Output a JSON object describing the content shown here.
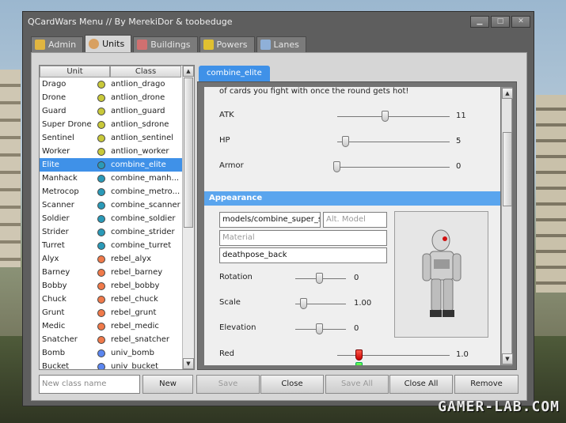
{
  "window": {
    "title": "QCardWars Menu  //  By MerekiDor & toobeduge"
  },
  "tabs": [
    {
      "label": "Admin",
      "color": "#e0b540"
    },
    {
      "label": "Units",
      "color": "#d8a060"
    },
    {
      "label": "Buildings",
      "color": "#d07070"
    },
    {
      "label": "Powers",
      "color": "#e0c030"
    },
    {
      "label": "Lanes",
      "color": "#8fb0d8"
    }
  ],
  "list": {
    "headers": {
      "unit": "Unit",
      "cls": "Class"
    },
    "rows": [
      {
        "unit": "Drago",
        "cls": "antlion_drago",
        "color": "#c9c93a"
      },
      {
        "unit": "Drone",
        "cls": "antlion_drone",
        "color": "#c9c93a"
      },
      {
        "unit": "Guard",
        "cls": "antlion_guard",
        "color": "#c9c93a"
      },
      {
        "unit": "Super Drone",
        "cls": "antlion_sdrone",
        "color": "#c9c93a"
      },
      {
        "unit": "Sentinel",
        "cls": "antlion_sentinel",
        "color": "#c9c93a"
      },
      {
        "unit": "Worker",
        "cls": "antlion_worker",
        "color": "#c9c93a"
      },
      {
        "unit": "Elite",
        "cls": "combine_elite",
        "color": "#2a9ab8",
        "selected": true
      },
      {
        "unit": "Manhack",
        "cls": "combine_manh...",
        "color": "#2a9ab8"
      },
      {
        "unit": "Metrocop",
        "cls": "combine_metro...",
        "color": "#2a9ab8"
      },
      {
        "unit": "Scanner",
        "cls": "combine_scanner",
        "color": "#2a9ab8"
      },
      {
        "unit": "Soldier",
        "cls": "combine_soldier",
        "color": "#2a9ab8"
      },
      {
        "unit": "Strider",
        "cls": "combine_strider",
        "color": "#2a9ab8"
      },
      {
        "unit": "Turret",
        "cls": "combine_turret",
        "color": "#2a9ab8"
      },
      {
        "unit": "Alyx",
        "cls": "rebel_alyx",
        "color": "#f07a4a"
      },
      {
        "unit": "Barney",
        "cls": "rebel_barney",
        "color": "#f07a4a"
      },
      {
        "unit": "Bobby",
        "cls": "rebel_bobby",
        "color": "#f07a4a"
      },
      {
        "unit": "Chuck",
        "cls": "rebel_chuck",
        "color": "#f07a4a"
      },
      {
        "unit": "Grunt",
        "cls": "rebel_grunt",
        "color": "#f07a4a"
      },
      {
        "unit": "Medic",
        "cls": "rebel_medic",
        "color": "#f07a4a"
      },
      {
        "unit": "Snatcher",
        "cls": "rebel_snatcher",
        "color": "#f07a4a"
      },
      {
        "unit": "Bomb",
        "cls": "univ_bomb",
        "color": "#5b86f0"
      },
      {
        "unit": "Bucket",
        "cls": "univ_bucket",
        "color": "#5b86f0"
      }
    ]
  },
  "editor": {
    "tab_label": "combine_elite",
    "description": "of cards you fight with once the round gets hot!",
    "stats": [
      {
        "label": "ATK",
        "value": "11"
      },
      {
        "label": "HP",
        "value": "5"
      },
      {
        "label": "Armor",
        "value": "0"
      }
    ],
    "appearance": {
      "title": "Appearance",
      "model_value": "models/combine_super_so",
      "alt_model_placeholder": "Alt. Model",
      "material_placeholder": "Material",
      "pose_value": "deathpose_back",
      "rotation": {
        "label": "Rotation",
        "value": "0"
      },
      "scale": {
        "label": "Scale",
        "value": "1.00"
      },
      "elevation": {
        "label": "Elevation",
        "value": "0"
      },
      "red": {
        "label": "Red",
        "value": "1.0"
      }
    }
  },
  "bottom": {
    "new_class_placeholder": "New class name",
    "buttons": [
      "New",
      "Save",
      "Close",
      "Save All",
      "Close All",
      "Remove"
    ]
  },
  "watermark": "GAMER-LAB.COM"
}
